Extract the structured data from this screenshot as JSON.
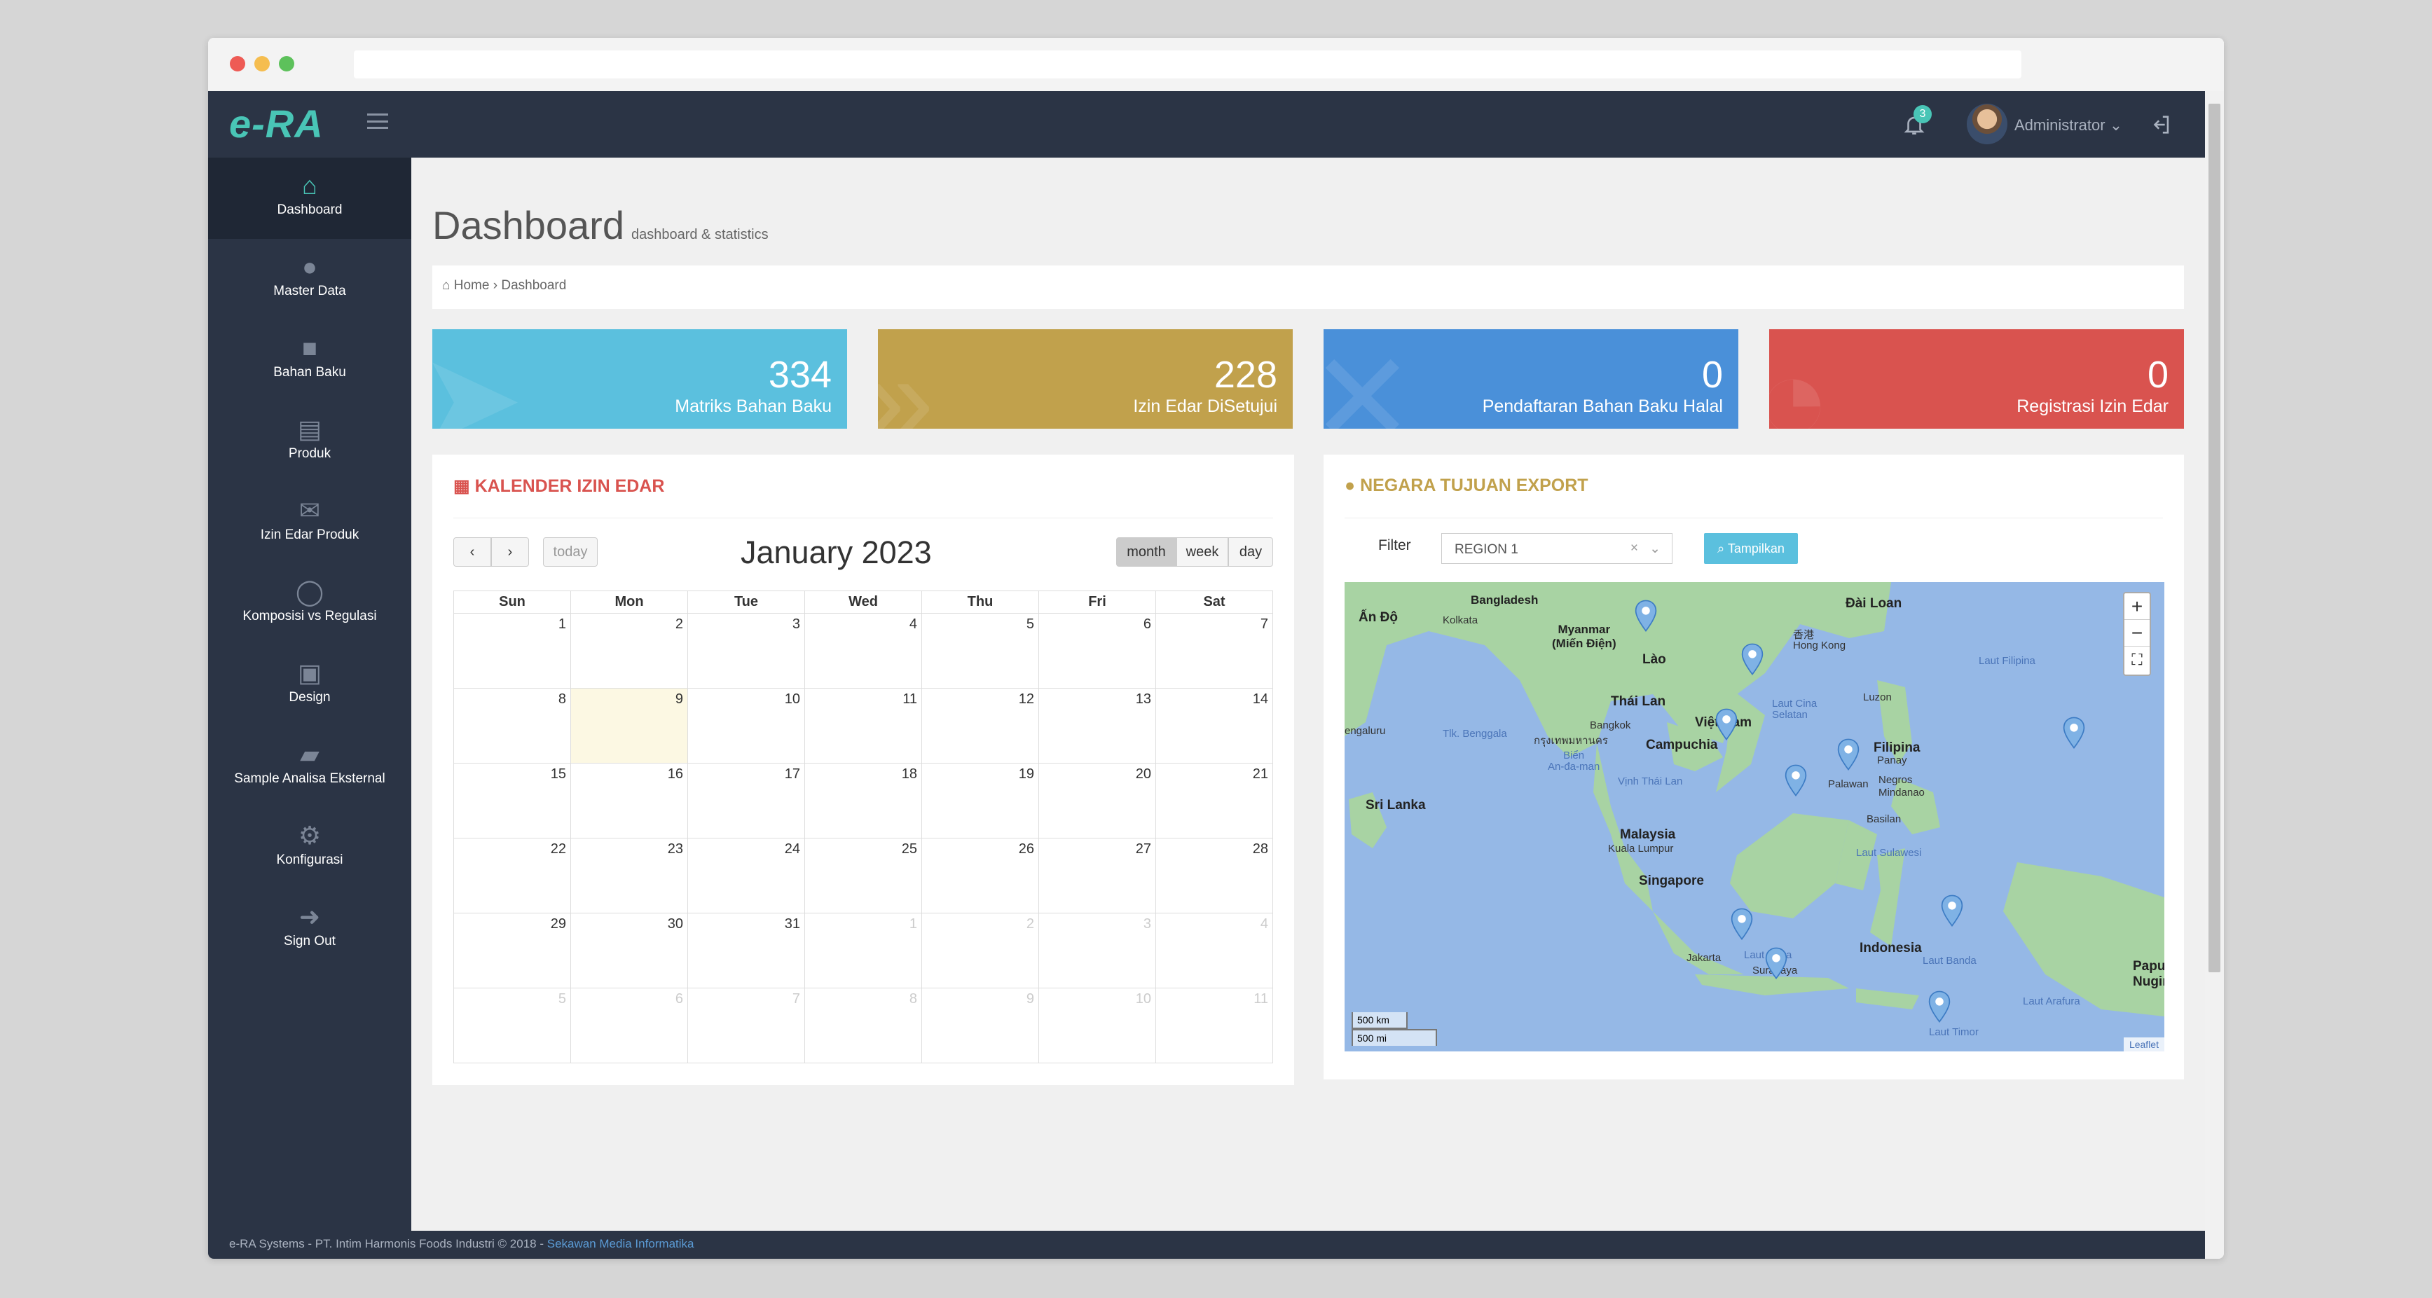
{
  "app": {
    "logo": "e-RA",
    "notification_count": "3",
    "user_name": "Administrator"
  },
  "sidebar": {
    "items": [
      {
        "label": "Dashboard"
      },
      {
        "label": "Master Data"
      },
      {
        "label": "Bahan Baku"
      },
      {
        "label": "Produk"
      },
      {
        "label": "Izin Edar Produk"
      },
      {
        "label": "Komposisi vs Regulasi"
      },
      {
        "label": "Design"
      },
      {
        "label": "Sample Analisa Eksternal"
      },
      {
        "label": "Konfigurasi"
      },
      {
        "label": "Sign Out"
      }
    ]
  },
  "page": {
    "title": "Dashboard",
    "subtitle": "dashboard & statistics"
  },
  "breadcrumb": {
    "home": "Home",
    "current": "Dashboard"
  },
  "stats": [
    {
      "value": "334",
      "label": "Matriks Bahan Baku",
      "color": "#5bc0de"
    },
    {
      "value": "228",
      "label": "Izin Edar DiSetujui",
      "color": "#c1a14c"
    },
    {
      "value": "0",
      "label": "Pendaftaran Bahan Baku Halal",
      "color": "#4a90d9"
    },
    {
      "value": "0",
      "label": "Registrasi Izin Edar",
      "color": "#d9534f"
    }
  ],
  "calendar": {
    "panel_title": "KALENDER IZIN EDAR",
    "month_title": "January 2023",
    "today_label": "today",
    "views": [
      "month",
      "week",
      "day"
    ],
    "weekdays": [
      "Sun",
      "Mon",
      "Tue",
      "Wed",
      "Thu",
      "Fri",
      "Sat"
    ],
    "today_date": "9",
    "weeks": [
      [
        "1",
        "2",
        "3",
        "4",
        "5",
        "6",
        "7"
      ],
      [
        "8",
        "9",
        "10",
        "11",
        "12",
        "13",
        "14"
      ],
      [
        "15",
        "16",
        "17",
        "18",
        "19",
        "20",
        "21"
      ],
      [
        "22",
        "23",
        "24",
        "25",
        "26",
        "27",
        "28"
      ],
      [
        "29",
        "30",
        "31",
        "1",
        "2",
        "3",
        "4"
      ],
      [
        "5",
        "6",
        "7",
        "8",
        "9",
        "10",
        "11"
      ]
    ]
  },
  "export": {
    "panel_title": "NEGARA TUJUAN EXPORT",
    "filter_label": "Filter",
    "filter_value": "REGION 1",
    "button_label": "Tampilkan",
    "map_labels": {
      "an_do": "Ấn Độ",
      "bangladesh": "Bangladesh",
      "kolkata": "Kolkata",
      "myanmar": "Myanmar\n(Miến Điện)",
      "lao": "Lào",
      "dai_loan": "Đài Loan",
      "hong_kong": "Hong Kong",
      "hk_cn": "香港",
      "thai_lan": "Thái Lan",
      "bangkok": "Bangkok",
      "bangkok_th": "กรุงเทพมหานคร",
      "viet_nam": "Việt Nam",
      "campuchia": "Campuchia",
      "luzon": "Luzon",
      "filipina": "Filipina",
      "panay": "Panay",
      "negros": "Negros",
      "mindanao": "Mindanao",
      "palawan": "Palawan",
      "basilan": "Basilan",
      "laut_filipina": "Laut Filipina",
      "laut_cina": "Laut Cina\nSelatan",
      "tlk_benggala": "Tlk. Benggala",
      "bien_andaman": "Biển\nAn-đa-man",
      "vinh_thai_lan": "Vịnh Thái Lan",
      "sri_lanka": "Sri Lanka",
      "engaluru": "engaluru",
      "malaysia": "Malaysia",
      "kuala_lumpur": "Kuala Lumpur",
      "singapore": "Singapore",
      "laut_sulawesi": "Laut Sulawesi",
      "indonesia": "Indonesia",
      "jakarta": "Jakarta",
      "laut_jawa": "Laut Jawa",
      "surabaya": "Surabaya",
      "laut_banda": "Laut Banda",
      "laut_arafura": "Laut Arafura",
      "laut_timor": "Laut Timor",
      "papua": "Papu\nNugin",
      "scale_km": "500 km",
      "scale_mi": "500 mi",
      "attribution": "Leaflet"
    }
  },
  "footer": {
    "text": "e-RA Systems - PT. Intim Harmonis Foods Industri © 2018 - ",
    "link": "Sekawan Media Informatika"
  }
}
